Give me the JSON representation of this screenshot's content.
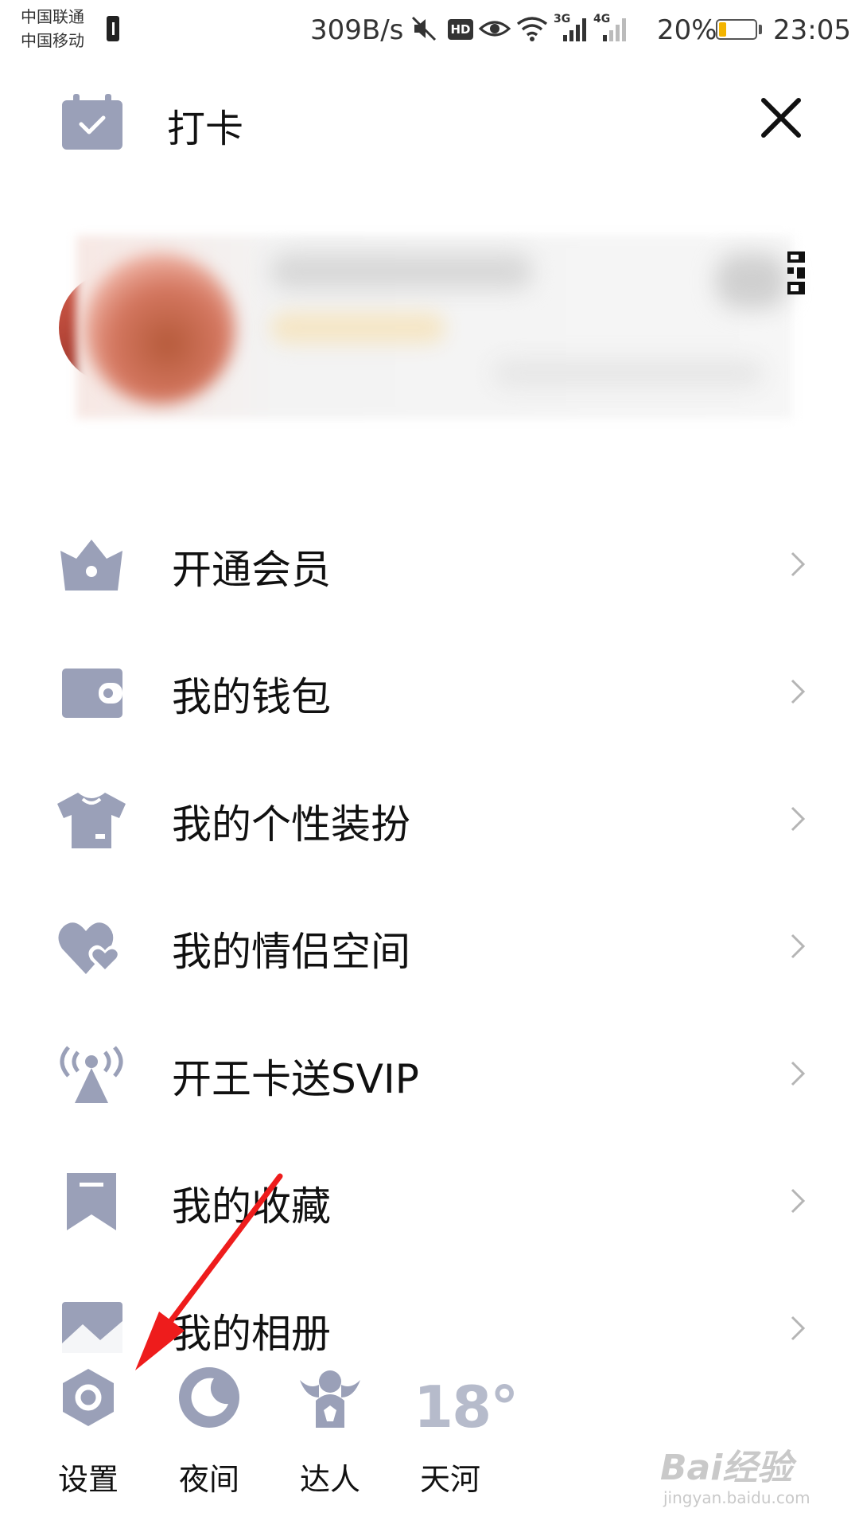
{
  "status_bar": {
    "carrier_1": "中国联通",
    "carrier_2": "中国移动",
    "net_speed": "309B/s",
    "hd": "HD",
    "net_3g": "3G",
    "net_4g": "4G",
    "battery_percent": "20%",
    "battery_level": 0.2,
    "time": "23:05"
  },
  "header": {
    "checkin_label": "打卡"
  },
  "colors": {
    "icon_gray": "#9aa0b8",
    "chevron": "#b5b5b5",
    "annotation_red": "#ee1c1c",
    "battery_fill": "#f3b400"
  },
  "menu": {
    "items": [
      {
        "label": "开通会员",
        "icon": "crown-icon"
      },
      {
        "label": "我的钱包",
        "icon": "wallet-icon"
      },
      {
        "label": "我的个性装扮",
        "icon": "tshirt-icon"
      },
      {
        "label": "我的情侣空间",
        "icon": "hearts-icon"
      },
      {
        "label": "开王卡送SVIP",
        "icon": "signal-tower-icon"
      },
      {
        "label": "我的收藏",
        "icon": "bookmark-icon"
      },
      {
        "label": "我的相册",
        "icon": "photo-album-icon"
      }
    ]
  },
  "toolbar": {
    "settings_label": "设置",
    "night_label": "夜间",
    "expert_label": "达人",
    "weather_temp": "18°",
    "weather_location": "天河"
  },
  "watermark": {
    "brand": "Bai经验",
    "url": "jingyan.baidu.com"
  }
}
